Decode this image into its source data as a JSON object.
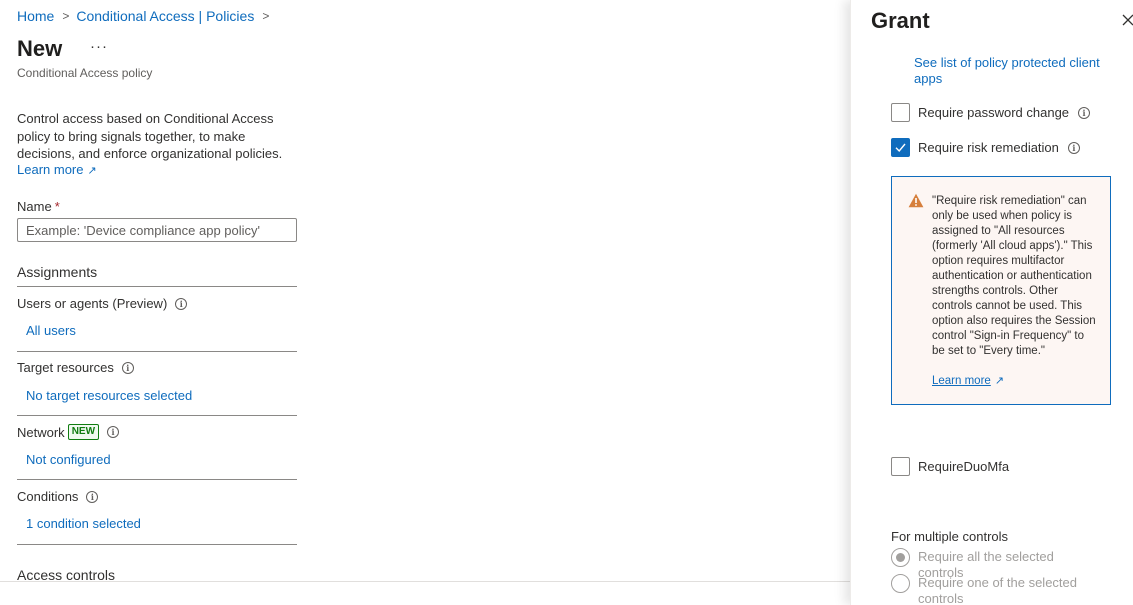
{
  "breadcrumb": {
    "items": [
      "Home",
      "Conditional Access | Policies"
    ],
    "separator": ">"
  },
  "page": {
    "title": "New",
    "more": "···",
    "subtitle": "Conditional Access policy",
    "description": "Control access based on Conditional Access policy to bring signals together, to make decisions, and enforce organizational policies.",
    "learn_more": "Learn more"
  },
  "name_field": {
    "label": "Name",
    "required_mark": "*",
    "placeholder": "Example: 'Device compliance app policy'",
    "value": ""
  },
  "assignments": {
    "title": "Assignments",
    "rows": [
      {
        "label": "Users or agents (Preview)",
        "value": "All users"
      },
      {
        "label": "Target resources",
        "value": "No target resources selected"
      },
      {
        "label": "Network",
        "badge": "NEW",
        "value": "Not configured"
      },
      {
        "label": "Conditions",
        "value": "1 condition selected"
      }
    ]
  },
  "access_controls": {
    "title": "Access controls"
  },
  "grant_panel": {
    "title": "Grant",
    "client_apps_link": "See list of policy protected client apps",
    "options": [
      {
        "label": "Require password change",
        "checked": false
      },
      {
        "label": "Require risk remediation",
        "checked": true
      },
      {
        "label": "RequireDuoMfa",
        "checked": false
      }
    ],
    "warning": {
      "text": "\"Require risk remediation\" can only be used when policy is assigned to \"All resources (formerly 'All cloud apps').\" This option requires multifactor authentication or authentication strengths controls. Other controls cannot be used. This option also requires the Session control \"Sign-in Frequency\" to be set to \"Every time.\"",
      "learn_more": "Learn more"
    },
    "multiple_controls": {
      "label": "For multiple controls",
      "options": [
        {
          "label": "Require all the selected controls",
          "selected": true
        },
        {
          "label": "Require one of the selected controls",
          "selected": false
        }
      ]
    }
  },
  "colors": {
    "accent": "#0f6cbd",
    "warning": "#d67f3c",
    "warning_bg": "#fdf6f3",
    "badge_green": "#107c10"
  },
  "icons": {
    "info": "info-icon",
    "external": "external-link-icon",
    "warning": "warning-icon",
    "close": "close-icon",
    "chevron": "chevron-right-icon",
    "check": "checkmark-icon"
  }
}
